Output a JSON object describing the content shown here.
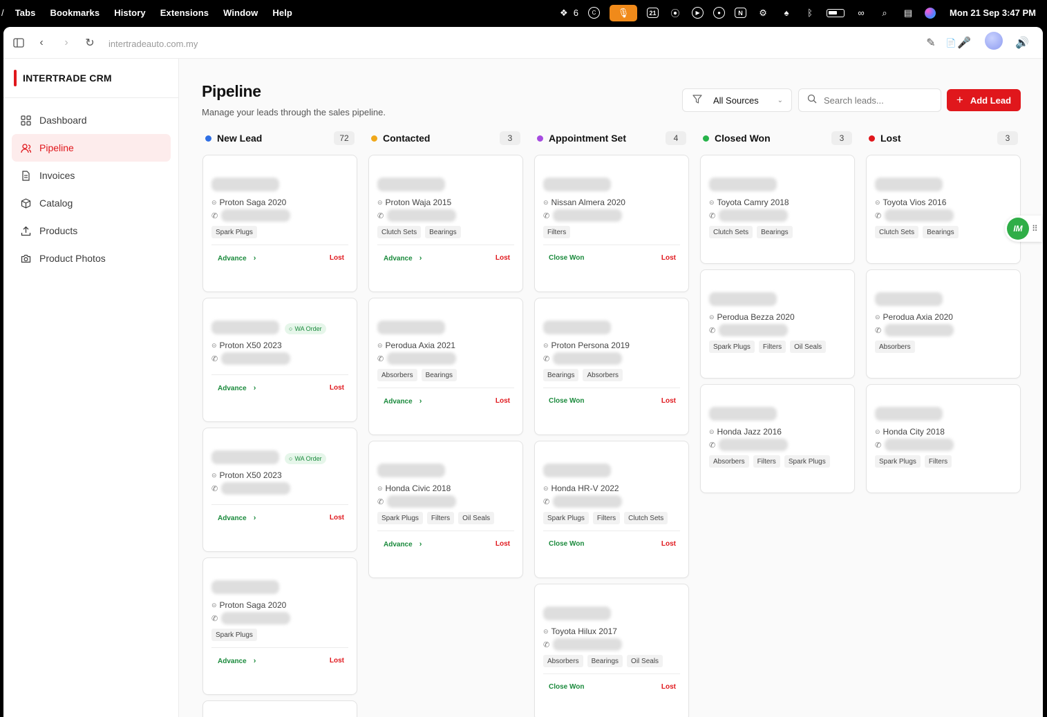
{
  "menubar": {
    "menus": [
      "Tabs",
      "Bookmarks",
      "History",
      "Extensions",
      "Window",
      "Help"
    ],
    "notif_count": "6",
    "calendar_day": "21",
    "clock": "Mon 21 Sep  3:47 PM"
  },
  "browser": {
    "url": "intertradeauto.com.my"
  },
  "sidebar": {
    "brand": "INTERTRADE CRM",
    "items": [
      {
        "label": "Dashboard",
        "icon": "grid-icon"
      },
      {
        "label": "Pipeline",
        "icon": "users-icon",
        "active": true
      },
      {
        "label": "Invoices",
        "icon": "file-icon"
      },
      {
        "label": "Catalog",
        "icon": "package-icon"
      },
      {
        "label": "Products",
        "icon": "upload-icon"
      },
      {
        "label": "Product Photos",
        "icon": "camera-icon"
      }
    ]
  },
  "header": {
    "title": "Pipeline",
    "subtitle": "Manage your leads through the sales pipeline.",
    "filter_value": "All Sources",
    "search_placeholder": "Search leads...",
    "add_label": "Add Lead"
  },
  "colors": {
    "accent": "#e0171c",
    "new_lead": "#2f6fe4",
    "contacted": "#f0a81a",
    "appointment": "#a64be0",
    "closed_won": "#26b34a",
    "lost": "#e0171c"
  },
  "actions": {
    "advance": "Advance",
    "close_won": "Close Won",
    "lost": "Lost",
    "wa_order": "WA Order"
  },
  "columns": [
    {
      "title": "New Lead",
      "count": "72",
      "cards": [
        {
          "car": "Proton Saga 2020",
          "tags": [
            "Spark Plugs"
          ],
          "action": "advance"
        },
        {
          "car": "Proton X50 2023",
          "tags": [],
          "action": "advance",
          "wa": true
        },
        {
          "car": "Proton X50 2023",
          "tags": [],
          "action": "advance",
          "wa": true
        },
        {
          "car": "Proton Saga 2020",
          "tags": [
            "Spark Plugs"
          ],
          "action": "advance"
        }
      ]
    },
    {
      "title": "Contacted",
      "count": "3",
      "cards": [
        {
          "car": "Proton Waja 2015",
          "tags": [
            "Clutch Sets",
            "Bearings"
          ],
          "action": "advance"
        },
        {
          "car": "Perodua Axia 2021",
          "tags": [
            "Absorbers",
            "Bearings"
          ],
          "action": "advance"
        },
        {
          "car": "Honda Civic 2018",
          "tags": [
            "Spark Plugs",
            "Filters",
            "Oil Seals"
          ],
          "action": "advance"
        }
      ]
    },
    {
      "title": "Appointment Set",
      "count": "4",
      "cards": [
        {
          "car": "Nissan Almera 2020",
          "tags": [
            "Filters"
          ],
          "action": "won"
        },
        {
          "car": "Proton Persona 2019",
          "tags": [
            "Bearings",
            "Absorbers"
          ],
          "action": "won"
        },
        {
          "car": "Honda HR-V 2022",
          "tags": [
            "Spark Plugs",
            "Filters",
            "Clutch Sets"
          ],
          "action": "won"
        },
        {
          "car": "Toyota Hilux 2017",
          "tags": [
            "Absorbers",
            "Bearings",
            "Oil Seals"
          ],
          "action": "won"
        }
      ]
    },
    {
      "title": "Closed Won",
      "count": "3",
      "cards": [
        {
          "car": "Toyota Camry 2018",
          "tags": [
            "Clutch Sets",
            "Bearings"
          ]
        },
        {
          "car": "Perodua Bezza 2020",
          "tags": [
            "Spark Plugs",
            "Filters",
            "Oil Seals"
          ]
        },
        {
          "car": "Honda Jazz 2016",
          "tags": [
            "Absorbers",
            "Filters",
            "Spark Plugs"
          ]
        }
      ]
    },
    {
      "title": "Lost",
      "count": "3",
      "cards": [
        {
          "car": "Toyota Vios 2016",
          "tags": [
            "Clutch Sets",
            "Bearings"
          ]
        },
        {
          "car": "Perodua Axia 2020",
          "tags": [
            "Absorbers"
          ]
        },
        {
          "car": "Honda City 2018",
          "tags": [
            "Spark Plugs",
            "Filters"
          ]
        }
      ]
    }
  ],
  "floating_widget": {
    "logo_text": "IM"
  }
}
